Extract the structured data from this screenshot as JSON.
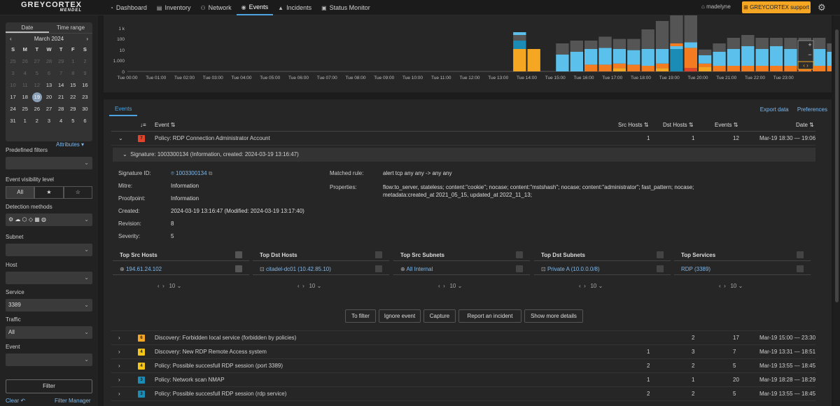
{
  "nav": {
    "logo": "GREYCORTEX",
    "logo_sub": "MENDEL",
    "items": [
      {
        "label": "Dashboard",
        "icon": "dashboard-icon",
        "glyph": "◔"
      },
      {
        "label": "Inventory",
        "icon": "inventory-icon",
        "glyph": "▤"
      },
      {
        "label": "Network",
        "icon": "network-icon",
        "glyph": "⚇"
      },
      {
        "label": "Events",
        "icon": "events-icon",
        "glyph": "◉",
        "active": true
      },
      {
        "label": "Incidents",
        "icon": "incidents-icon",
        "glyph": "▲"
      },
      {
        "label": "Status Monitor",
        "icon": "status-monitor-icon",
        "glyph": "▣"
      }
    ],
    "user": "madelyne",
    "support": "GREYCORTEX support"
  },
  "calendar": {
    "tabs": [
      "Date",
      "Time range"
    ],
    "month": "March 2024",
    "dayheads": [
      "S",
      "M",
      "T",
      "W",
      "T",
      "F",
      "S"
    ],
    "rows": [
      [
        {
          "d": "25",
          "s": "dim"
        },
        {
          "d": "26",
          "s": "dim"
        },
        {
          "d": "27",
          "s": "dim"
        },
        {
          "d": "28",
          "s": "dim"
        },
        {
          "d": "29",
          "s": "dim"
        },
        {
          "d": "1",
          "s": "dim"
        },
        {
          "d": "2",
          "s": "dim"
        }
      ],
      [
        {
          "d": "3",
          "s": "dim"
        },
        {
          "d": "4",
          "s": "dim"
        },
        {
          "d": "5",
          "s": "dim"
        },
        {
          "d": "6",
          "s": "dim"
        },
        {
          "d": "7",
          "s": "dim"
        },
        {
          "d": "8",
          "s": "dim"
        },
        {
          "d": "9",
          "s": "dim"
        }
      ],
      [
        {
          "d": "10",
          "s": "dim"
        },
        {
          "d": "11",
          "s": "dim"
        },
        {
          "d": "12",
          "s": "dim"
        },
        {
          "d": "13",
          "s": "cur"
        },
        {
          "d": "14",
          "s": "cur"
        },
        {
          "d": "15",
          "s": "cur"
        },
        {
          "d": "16",
          "s": "cur"
        }
      ],
      [
        {
          "d": "17",
          "s": "cur"
        },
        {
          "d": "18",
          "s": "cur"
        },
        {
          "d": "19",
          "s": "today"
        },
        {
          "d": "20",
          "s": "cur"
        },
        {
          "d": "21",
          "s": "cur"
        },
        {
          "d": "22",
          "s": "cur"
        },
        {
          "d": "23",
          "s": "cur"
        }
      ],
      [
        {
          "d": "24",
          "s": "cur"
        },
        {
          "d": "25",
          "s": "cur"
        },
        {
          "d": "26",
          "s": "cur"
        },
        {
          "d": "27",
          "s": "cur"
        },
        {
          "d": "28",
          "s": "cur"
        },
        {
          "d": "29",
          "s": "cur"
        },
        {
          "d": "30",
          "s": "cur"
        }
      ],
      [
        {
          "d": "31",
          "s": "cur"
        },
        {
          "d": "1",
          "s": "cur"
        },
        {
          "d": "2",
          "s": "cur"
        },
        {
          "d": "3",
          "s": "cur"
        },
        {
          "d": "4",
          "s": "cur"
        },
        {
          "d": "5",
          "s": "cur"
        },
        {
          "d": "6",
          "s": "cur"
        }
      ]
    ]
  },
  "filters": {
    "attributes": "Attributes",
    "predefined": "Predefined filters",
    "visibility": "Event visibility level",
    "vis_all": "All",
    "detection": "Detection methods",
    "subnet": "Subnet",
    "host": "Host",
    "service": "Service",
    "service_value": "3389",
    "traffic": "Traffic",
    "traffic_value": "All",
    "event": "Event",
    "filter_button": "Filter",
    "clear": "Clear",
    "filter_manager": "Filter Manager"
  },
  "chart_data": {
    "type": "bar",
    "stacked": true,
    "yscale": "log",
    "yticks": [
      "1 k",
      "100",
      "10",
      "1.000",
      "0"
    ],
    "xticks": [
      "Tue 00:00",
      "Tue 01:00",
      "Tue 02:00",
      "Tue 03:00",
      "Tue 04:00",
      "Tue 05:00",
      "Tue 06:00",
      "Tue 07:00",
      "Tue 08:00",
      "Tue 09:00",
      "Tue 10:00",
      "Tue 11:00",
      "Tue 12:00",
      "Tue 13:00",
      "Tue 14:00",
      "Tue 15:00",
      "Tue 16:00",
      "Tue 17:00",
      "Tue 18:00",
      "Tue 19:00",
      "Tue 20:00",
      "Tue 21:00",
      "Tue 22:00",
      "Tue 23:00"
    ],
    "colors": {
      "yellow": "#f5a623",
      "cyan": "#5bc0eb",
      "orange": "#f47c20",
      "teal": "#1a8cb5",
      "grey": "#555555",
      "red": "#e0452b"
    },
    "stacks": [
      {
        "slot": 0,
        "segs": [
          [
            "yellow",
            4
          ],
          [
            "teal",
            1.5
          ],
          [
            "grey",
            1
          ],
          [
            "cyan",
            0.5
          ]
        ]
      },
      {
        "slot": 1,
        "segs": [
          [
            "yellow",
            4
          ]
        ]
      },
      {
        "slot": 3,
        "segs": [
          [
            "cyan",
            3
          ],
          [
            "grey",
            2
          ]
        ]
      },
      {
        "slot": 4,
        "segs": [
          [
            "cyan",
            3.5
          ],
          [
            "grey",
            2
          ]
        ]
      },
      {
        "slot": 5,
        "segs": [
          [
            "orange",
            1.2
          ],
          [
            "cyan",
            2.8
          ],
          [
            "grey",
            1.5
          ]
        ]
      },
      {
        "slot": 6,
        "segs": [
          [
            "orange",
            1.2
          ],
          [
            "cyan",
            3
          ],
          [
            "grey",
            2
          ]
        ]
      },
      {
        "slot": 7,
        "segs": [
          [
            "yellow",
            0.6
          ],
          [
            "orange",
            0.8
          ],
          [
            "cyan",
            2.6
          ],
          [
            "grey",
            1.8
          ]
        ]
      },
      {
        "slot": 8,
        "segs": [
          [
            "orange",
            1.2
          ],
          [
            "cyan",
            2.6
          ],
          [
            "grey",
            2
          ]
        ]
      },
      {
        "slot": 9,
        "segs": [
          [
            "orange",
            1
          ],
          [
            "cyan",
            3
          ],
          [
            "grey",
            3.5
          ]
        ]
      },
      {
        "slot": 10,
        "segs": [
          [
            "yellow",
            0.6
          ],
          [
            "orange",
            0.8
          ],
          [
            "cyan",
            2.6
          ],
          [
            "grey",
            5
          ]
        ]
      },
      {
        "slot": 11,
        "segs": [
          [
            "teal",
            4
          ],
          [
            "cyan",
            0.5
          ],
          [
            "orange",
            0.5
          ],
          [
            "grey",
            7
          ]
        ]
      },
      {
        "slot": 12,
        "segs": [
          [
            "red",
            0.6
          ],
          [
            "orange",
            3.6
          ],
          [
            "cyan",
            1
          ],
          [
            "grey",
            6
          ]
        ]
      },
      {
        "slot": 13,
        "segs": [
          [
            "yellow",
            0.8
          ],
          [
            "orange",
            0.6
          ],
          [
            "cyan",
            1.5
          ],
          [
            "grey",
            1
          ]
        ]
      },
      {
        "slot": 14,
        "segs": [
          [
            "orange",
            1
          ],
          [
            "cyan",
            2.5
          ],
          [
            "grey",
            1.5
          ]
        ]
      },
      {
        "slot": 15,
        "segs": [
          [
            "orange",
            1
          ],
          [
            "cyan",
            3
          ],
          [
            "grey",
            2
          ]
        ]
      },
      {
        "slot": 16,
        "segs": [
          [
            "orange",
            1
          ],
          [
            "cyan",
            3.5
          ],
          [
            "grey",
            2
          ]
        ]
      },
      {
        "slot": 17,
        "segs": [
          [
            "orange",
            1
          ],
          [
            "cyan",
            3
          ],
          [
            "grey",
            2
          ]
        ]
      },
      {
        "slot": 18,
        "segs": [
          [
            "orange",
            1
          ],
          [
            "cyan",
            3.5
          ],
          [
            "grey",
            1.5
          ]
        ]
      },
      {
        "slot": 19,
        "segs": [
          [
            "orange",
            1
          ],
          [
            "cyan",
            3
          ],
          [
            "grey",
            2
          ]
        ]
      },
      {
        "slot": 20,
        "segs": [
          [
            "orange",
            1
          ],
          [
            "cyan",
            3.5
          ],
          [
            "grey",
            1.5
          ]
        ]
      },
      {
        "slot": 21,
        "segs": [
          [
            "orange",
            1
          ],
          [
            "cyan",
            3
          ],
          [
            "grey",
            2
          ]
        ]
      },
      {
        "slot": 22,
        "segs": [
          [
            "orange",
            1
          ],
          [
            "cyan",
            2.5
          ],
          [
            "grey",
            1.5
          ]
        ]
      },
      {
        "slot": 23,
        "segs": [
          [
            "orange",
            1
          ],
          [
            "cyan",
            2
          ],
          [
            "grey",
            2
          ]
        ]
      }
    ]
  },
  "events": {
    "tab": "Events",
    "export": "Export data",
    "preferences": "Preferences",
    "columns": {
      "event": "Event",
      "src": "Src Hosts",
      "dst": "Dst Hosts",
      "count": "Events",
      "date": "Date"
    },
    "expanded": {
      "sev": "7",
      "sevColor": "#e0452b",
      "name": "Policy: RDP Connection Administrator Account",
      "src": "1",
      "dst": "1",
      "count": "12",
      "date": "Mar-19 18:30 — 19:06"
    },
    "signature_bar": "Signature: 1003300134 (Information, created: 2024-03-19 13:16:47)",
    "details": {
      "sigid_label": "Signature ID:",
      "sigid": "1003300134",
      "mitre_label": "Mitre:",
      "mitre": "Information",
      "proof_label": "Proofpoint:",
      "proof": "Information",
      "created_label": "Created:",
      "created": "2024-03-19 13:16:47 (Modified: 2024-03-19 13:17:40)",
      "rev_label": "Revision:",
      "rev": "8",
      "sev_label": "Severity:",
      "sev": "5",
      "rule_label": "Matched rule:",
      "rule": "alert tcp any any -> any any",
      "props_label": "Properties:",
      "props1": "flow:to_server, stateless; content:\"cookie\"; nocase; content:\"mstshash\"; nocase; content:\"administrator\"; fast_pattern; nocase;",
      "props2": "metadata:created_at 2021_05_15, updated_at 2022_11_13;"
    },
    "tops": [
      {
        "title": "Top Src Hosts",
        "value": "194.61.24.102",
        "icon": "globe-icon",
        "glyph": "⊕"
      },
      {
        "title": "Top Dst Hosts",
        "value": "citadel-dc01 (10.42.85.10)",
        "icon": "host-icon",
        "glyph": "⊡"
      },
      {
        "title": "Top Src Subnets",
        "value": "All Internal",
        "icon": "globe-icon",
        "glyph": "⊕"
      },
      {
        "title": "Top Dst Subnets",
        "value": "Private A (10.0.0.0/8)",
        "icon": "subnet-icon",
        "glyph": "⊡"
      },
      {
        "title": "Top Services",
        "value": "RDP (3389)",
        "icon": "",
        "glyph": ""
      }
    ],
    "page_size": "10",
    "actions": [
      "To filter",
      "Ignore event",
      "Capture",
      "Report an incident",
      "Show more details"
    ],
    "rows": [
      {
        "sev": "6",
        "sevColor": "#f5a623",
        "name": "Discovery: Forbidden local service (forbidden by policies)",
        "src": "",
        "dst": "2",
        "count": "17",
        "date": "Mar-19 15:00 — 23:30"
      },
      {
        "sev": "4",
        "sevColor": "#f5c518",
        "name": "Discovery: New RDP Remote Access system",
        "src": "1",
        "dst": "3",
        "count": "7",
        "date": "Mar-19 13:31 — 18:51"
      },
      {
        "sev": "4",
        "sevColor": "#f5c518",
        "name": "Policy: Possible succesfull RDP session (port 3389)",
        "src": "2",
        "dst": "2",
        "count": "5",
        "date": "Mar-19 13:55 — 18:45"
      },
      {
        "sev": "3",
        "sevColor": "#1a8cb5",
        "name": "Policy: Network scan NMAP",
        "src": "1",
        "dst": "1",
        "count": "20",
        "date": "Mar-19 18:28 — 18:29"
      },
      {
        "sev": "3",
        "sevColor": "#1a8cb5",
        "name": "Policy: Possible succesfull RDP session (rdp service)",
        "src": "2",
        "dst": "2",
        "count": "5",
        "date": "Mar-19 13:55 — 18:45"
      }
    ]
  }
}
